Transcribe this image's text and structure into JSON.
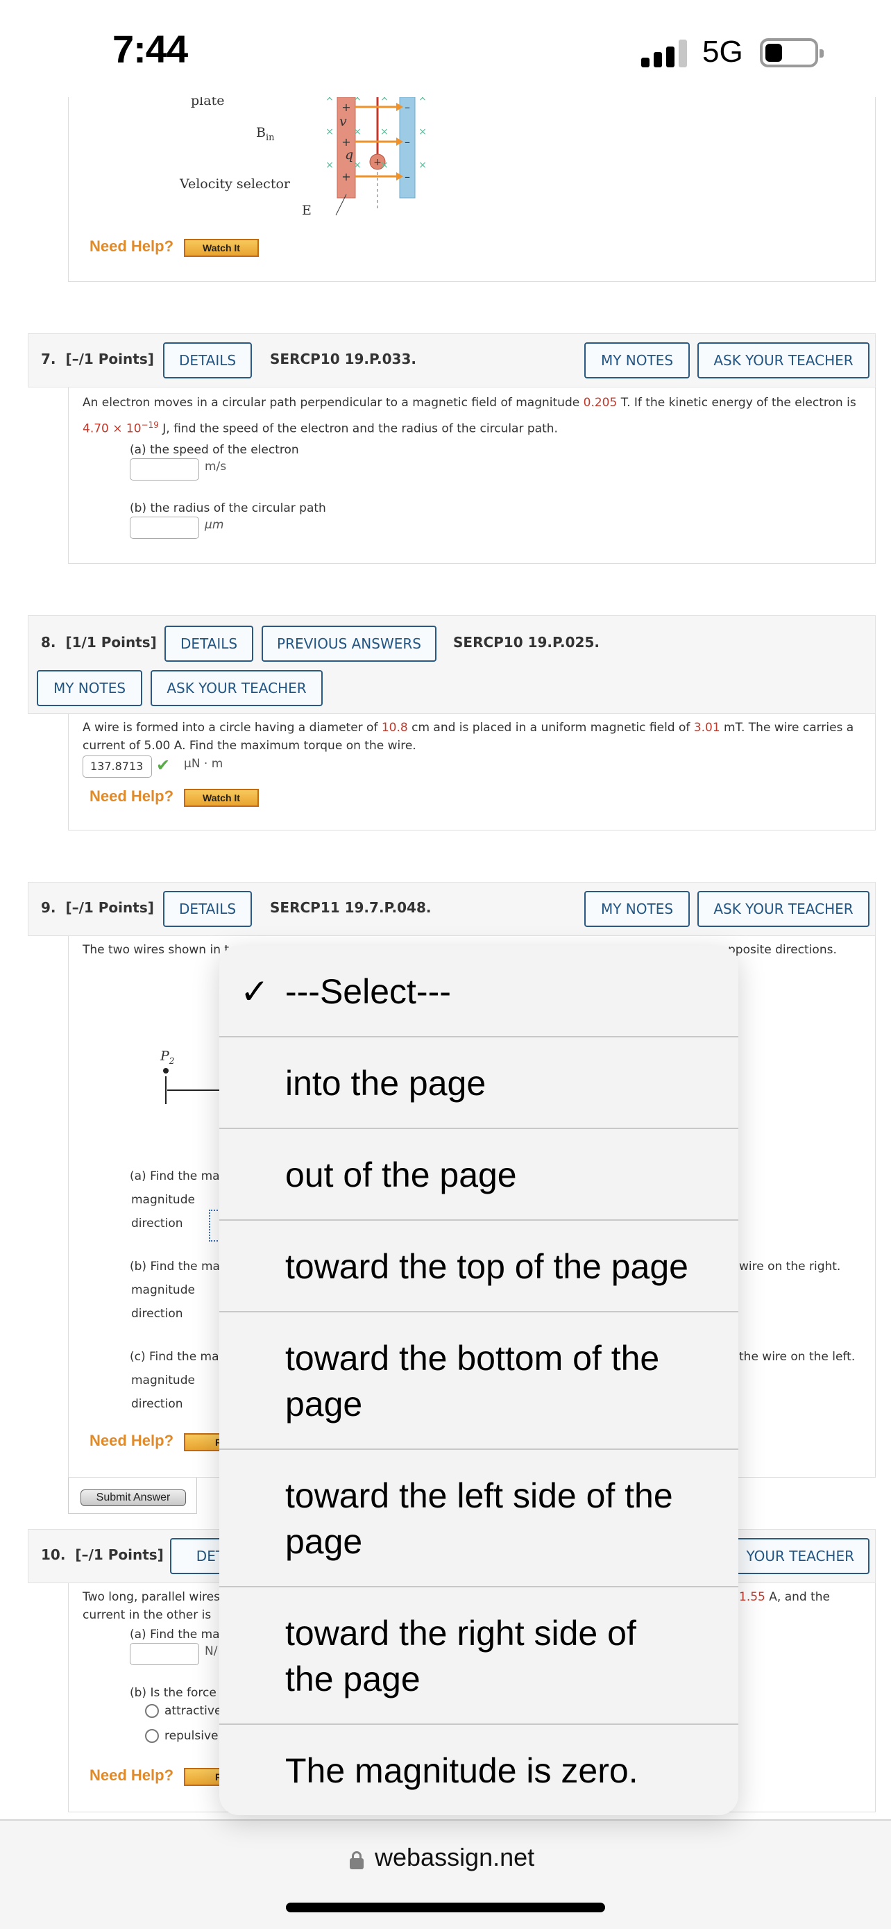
{
  "status_bar": {
    "time": "7:44",
    "network": "5G",
    "battery_level": 0.35
  },
  "q6": {
    "figure_labels": {
      "plate": "plate",
      "b_field": "B",
      "b_sub": "in",
      "velocity": "v",
      "charge": "q",
      "selector": "Velocity selector",
      "e_field": "E"
    },
    "need_help": "Need Help?",
    "watch_label": "Watch It"
  },
  "q7": {
    "number": "7.",
    "points": "[–/1 Points]",
    "details_label": "DETAILS",
    "code": "SERCP10 19.P.033.",
    "my_notes_label": "MY NOTES",
    "ask_teacher_label": "ASK YOUR TEACHER",
    "text_line1_a": "An electron moves in a circular path perpendicular to a magnetic field of magnitude ",
    "text_line1_val": "0.205",
    "text_line1_b": " T. If the kinetic energy of the electron is",
    "text_line2_val": "4.70 × 10",
    "text_line2_exp": "−19",
    "text_line2_b": " J, find the speed of the electron and the radius of the circular path.",
    "part_a": "(a) the speed of the electron",
    "part_a_value": "",
    "part_a_unit": "m/s",
    "part_b": "(b) the radius of the circular path",
    "part_b_value": "",
    "part_b_unit": "μm"
  },
  "q8": {
    "number": "8.",
    "points": "[1/1 Points]",
    "details_label": "DETAILS",
    "prev_answers_label": "PREVIOUS ANSWERS",
    "code": "SERCP10 19.P.025.",
    "my_notes_label": "MY NOTES",
    "ask_teacher_label": "ASK YOUR TEACHER",
    "text_a": "A wire is formed into a circle having a diameter of ",
    "diameter": "10.8",
    "text_b": " cm and is placed in a uniform magnetic field of ",
    "field": "3.01",
    "text_c": " mT. The wire carries a",
    "text_line2": "current of 5.00 A. Find the maximum torque on the wire.",
    "answer_value": "137.8713",
    "answer_unit": "μN · m",
    "answer_status": "correct",
    "need_help": "Need Help?",
    "watch_label": "Watch It"
  },
  "q9": {
    "number": "9.",
    "points": "[–/1 Points]",
    "details_label": "DETAILS",
    "code": "SERCP11 19.7.P.048.",
    "my_notes_label": "MY NOTES",
    "ask_teacher_label": "ASK YOUR TEACHER",
    "text_visible_start": "The two wires shown in t",
    "text_visible_end": "pposite directions.",
    "figure_point": "P",
    "figure_point_sub": "2",
    "part_a": "(a) Find the ma",
    "part_b": "(b) Find the ma",
    "part_b_end": "wire on the right.",
    "part_c": "(c) Find the ma",
    "part_c_end": "the wire on the left.",
    "magnitude_label": "magnitude",
    "direction_label": "direction",
    "need_help": "Need Help?",
    "read_label": "Re",
    "submit_label": "Submit Answer"
  },
  "q10": {
    "number": "10.",
    "points": "[–/1 Points]",
    "details_label": "DETA",
    "ask_teacher_label": "YOUR TEACHER",
    "text_line1_start": "Two long, parallel wires",
    "text_line1_val": "1.55",
    "text_line1_end": " A, and the",
    "text_line2_start": "current in the other is ",
    "part_a": "(a) Find the ma",
    "part_a_unit": "N/",
    "part_b": "(b) Is the force",
    "radio_options": [
      "attractive",
      "repulsive"
    ],
    "need_help": "Need Help?",
    "read_label": "Re"
  },
  "picker": {
    "selected_index": 0,
    "check": "✓",
    "options": [
      "---Select---",
      "into the page",
      "out of the page",
      "toward the top of the page",
      "toward the bottom of the page",
      "toward the left side of the page",
      "toward the right side of the page",
      "The magnitude is zero."
    ]
  },
  "browser": {
    "url": "webassign.net"
  }
}
